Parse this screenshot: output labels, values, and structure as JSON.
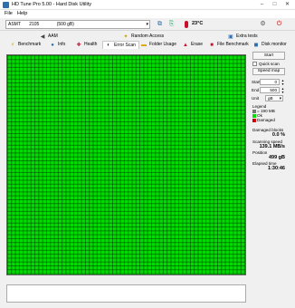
{
  "window": {
    "title": "HD Tune Pro 5.00 - Hard Disk Utility"
  },
  "menu": {
    "file": "File",
    "help": "Help"
  },
  "device": {
    "drive_name": "ASMT",
    "drive_model": "2105",
    "drive_size": "(500 gB)",
    "temperature": "23°C"
  },
  "tabs_row1": [
    {
      "label": "AAM",
      "icon": "speaker-icon"
    },
    {
      "label": "Random Access",
      "icon": "random-access-icon"
    },
    {
      "label": "Extra tests",
      "icon": "extra-tests-icon"
    }
  ],
  "tabs_row2": [
    {
      "label": "Benchmark",
      "icon": "benchmark-icon"
    },
    {
      "label": "Info",
      "icon": "info-icon"
    },
    {
      "label": "Health",
      "icon": "health-icon"
    },
    {
      "label": "Error Scan",
      "icon": "error-scan-icon"
    },
    {
      "label": "Folder Usage",
      "icon": "folder-icon"
    },
    {
      "label": "Erase",
      "icon": "erase-icon"
    },
    {
      "label": "File Benchmark",
      "icon": "file-benchmark-icon"
    },
    {
      "label": "Disk monitor",
      "icon": "disk-monitor-icon"
    }
  ],
  "controls": {
    "start_label": "Start",
    "quick_scan_label": "Quick scan",
    "speed_map_label": "Speed map",
    "start_field_label": "Start",
    "start_value": "0",
    "end_field_label": "End",
    "end_value": "500",
    "unit_label": "Unit",
    "unit_value": "gB"
  },
  "legend": {
    "title": "Legend",
    "block_size": "= 190 MB",
    "ok_label": "Ok",
    "damaged_label": "Damaged",
    "colors": {
      "ok": "#00dd00",
      "damaged": "#d00000",
      "block": "#777777"
    }
  },
  "stats": {
    "damaged_blocks_label": "Damaged blocks",
    "damaged_blocks_value": "0.0 %",
    "scanning_speed_label": "Scanning speed",
    "scanning_speed_value": "139.1 MB/s",
    "position_label": "Position",
    "position_value": "499 gB",
    "elapsed_label": "Elapsed time",
    "elapsed_value": "1:30:46"
  },
  "colors": {
    "block_ok": "#00dd00",
    "accent": "#2f6fb0"
  }
}
